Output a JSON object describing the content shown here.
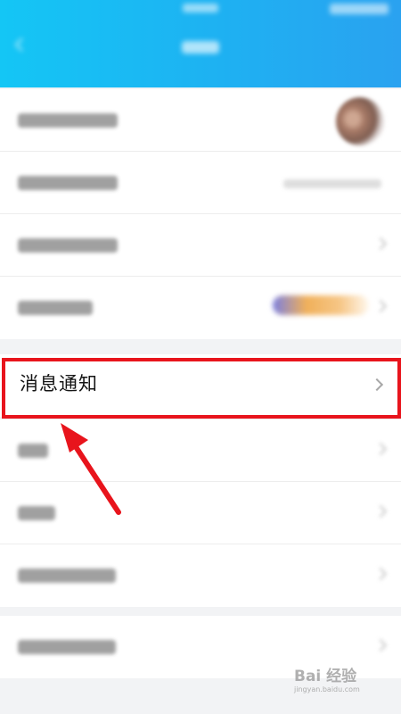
{
  "colors": {
    "header_start": "#14c6f5",
    "header_end": "#2aa2f0",
    "highlight": "#e8141c",
    "background": "#f2f3f5"
  },
  "highlighted_item": {
    "label": "消息通知",
    "icon": "chevron-right-icon"
  },
  "watermark": {
    "brand": "Bai 经验",
    "url": "jingyan.baidu.com"
  }
}
